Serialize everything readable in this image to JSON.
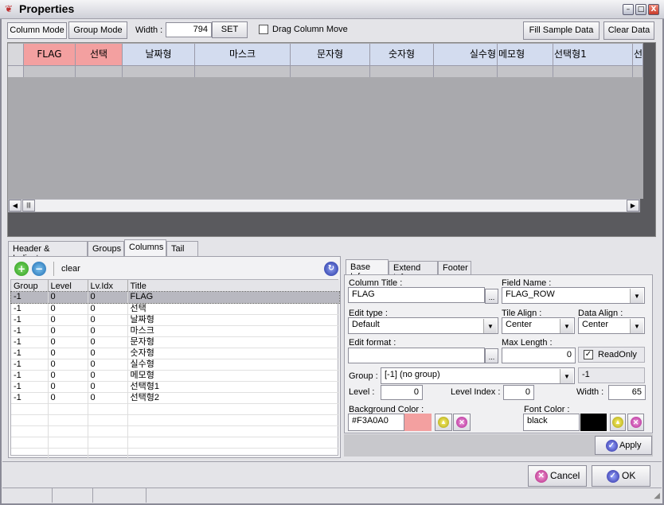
{
  "window": {
    "title": "Properties",
    "minimize": "–",
    "maximize": "□",
    "close": "X"
  },
  "toolbar": {
    "column_mode": "Column Mode",
    "group_mode": "Group Mode",
    "width_label": "Width :",
    "width_value": "794",
    "set": "SET",
    "drag_column_move": "Drag Column Move",
    "drag_checked": false,
    "fill_sample": "Fill Sample Data",
    "clear_data": "Clear Data"
  },
  "grid": {
    "columns": [
      {
        "title": "FLAG",
        "bg": "#F3A0A0",
        "align": "center"
      },
      {
        "title": "선택",
        "bg": "#F3A0A0",
        "align": "center"
      },
      {
        "title": "날짜형",
        "bg": "#D3DCEF",
        "align": "center"
      },
      {
        "title": "마스크",
        "bg": "#D3DCEF",
        "align": "center"
      },
      {
        "title": "문자형",
        "bg": "#D3DCEF",
        "align": "center"
      },
      {
        "title": "숫자형",
        "bg": "#D3DCEF",
        "align": "center"
      },
      {
        "title": "실수형",
        "bg": "#D3DCEF",
        "align": "right"
      },
      {
        "title": "메모형",
        "bg": "#D3DCEF",
        "align": "left"
      },
      {
        "title": "선택형1",
        "bg": "#D3DCEF",
        "align": "left"
      },
      {
        "title": "선",
        "bg": "#D3DCEF",
        "align": "left"
      }
    ]
  },
  "left_tabs": [
    "Header & Indicator",
    "Groups",
    "Columns",
    "Tail"
  ],
  "left_active_tab": "Columns",
  "columns_panel": {
    "clear": "clear",
    "headers": [
      "Group",
      "Level",
      "Lv.Idx",
      "Title"
    ],
    "rows": [
      [
        "-1",
        "0",
        "0",
        "FLAG"
      ],
      [
        "-1",
        "0",
        "0",
        "선택"
      ],
      [
        "-1",
        "0",
        "0",
        "날짜형"
      ],
      [
        "-1",
        "0",
        "0",
        "마스크"
      ],
      [
        "-1",
        "0",
        "0",
        "문자형"
      ],
      [
        "-1",
        "0",
        "0",
        "숫자형"
      ],
      [
        "-1",
        "0",
        "0",
        "실수형"
      ],
      [
        "-1",
        "0",
        "0",
        "메모형"
      ],
      [
        "-1",
        "0",
        "0",
        "선택형1"
      ],
      [
        "-1",
        "0",
        "0",
        "선택형2"
      ]
    ]
  },
  "right_tabs": [
    "Base Info",
    "Extend Info",
    "Footer"
  ],
  "right_active_tab": "Base Info",
  "base_info": {
    "column_title_label": "Column Title :",
    "column_title": "FLAG",
    "ellipsis": "...",
    "field_name_label": "Field Name :",
    "field_name": "FLAG_ROW",
    "edit_type_label": "Edit type :",
    "edit_type": "Default",
    "tile_align_label": "Tile Align :",
    "tile_align": "Center",
    "data_align_label": "Data Align :",
    "data_align": "Center",
    "edit_format_label": "Edit format :",
    "edit_format": "",
    "max_length_label": "Max Length :",
    "max_length": "0",
    "readonly_label": "ReadOnly",
    "readonly": true,
    "group_label": "Group :",
    "group": "[-1] (no group)",
    "group_value": "-1",
    "level_label": "Level :",
    "level": "0",
    "level_index_label": "Level Index :",
    "level_index": "0",
    "width_label": "Width :",
    "width": "65",
    "bg_color_label": "Background Color :",
    "bg_color": "#F3A0A0",
    "font_color_label": "Font Color :",
    "font_color": "black",
    "apply": "Apply"
  },
  "footer": {
    "cancel": "Cancel",
    "ok": "OK"
  },
  "colors": {
    "selected_header": "#F3A0A0",
    "header": "#D3DCEF",
    "font_swatch": "#000000"
  }
}
